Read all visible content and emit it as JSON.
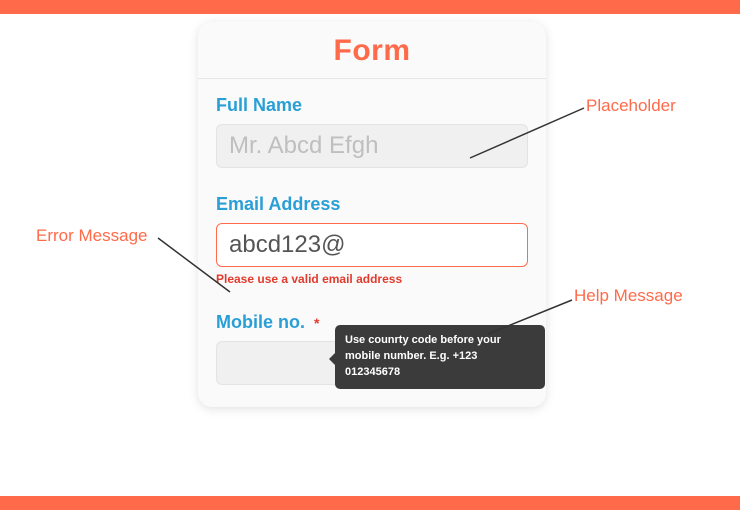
{
  "form": {
    "title": "Form",
    "fullName": {
      "label": "Full Name",
      "placeholder": "Mr. Abcd Efgh",
      "value": ""
    },
    "email": {
      "label": "Email Address",
      "value": "abcd123@",
      "error": "Please use a valid email address"
    },
    "mobile": {
      "label": "Mobile no.",
      "required_marker": "*",
      "value": "",
      "tooltip": "Use counrty code before your mobile number. E.g. +123 012345678"
    }
  },
  "annotations": {
    "placeholder": "Placeholder",
    "error": "Error Message",
    "help": "Help Message"
  }
}
